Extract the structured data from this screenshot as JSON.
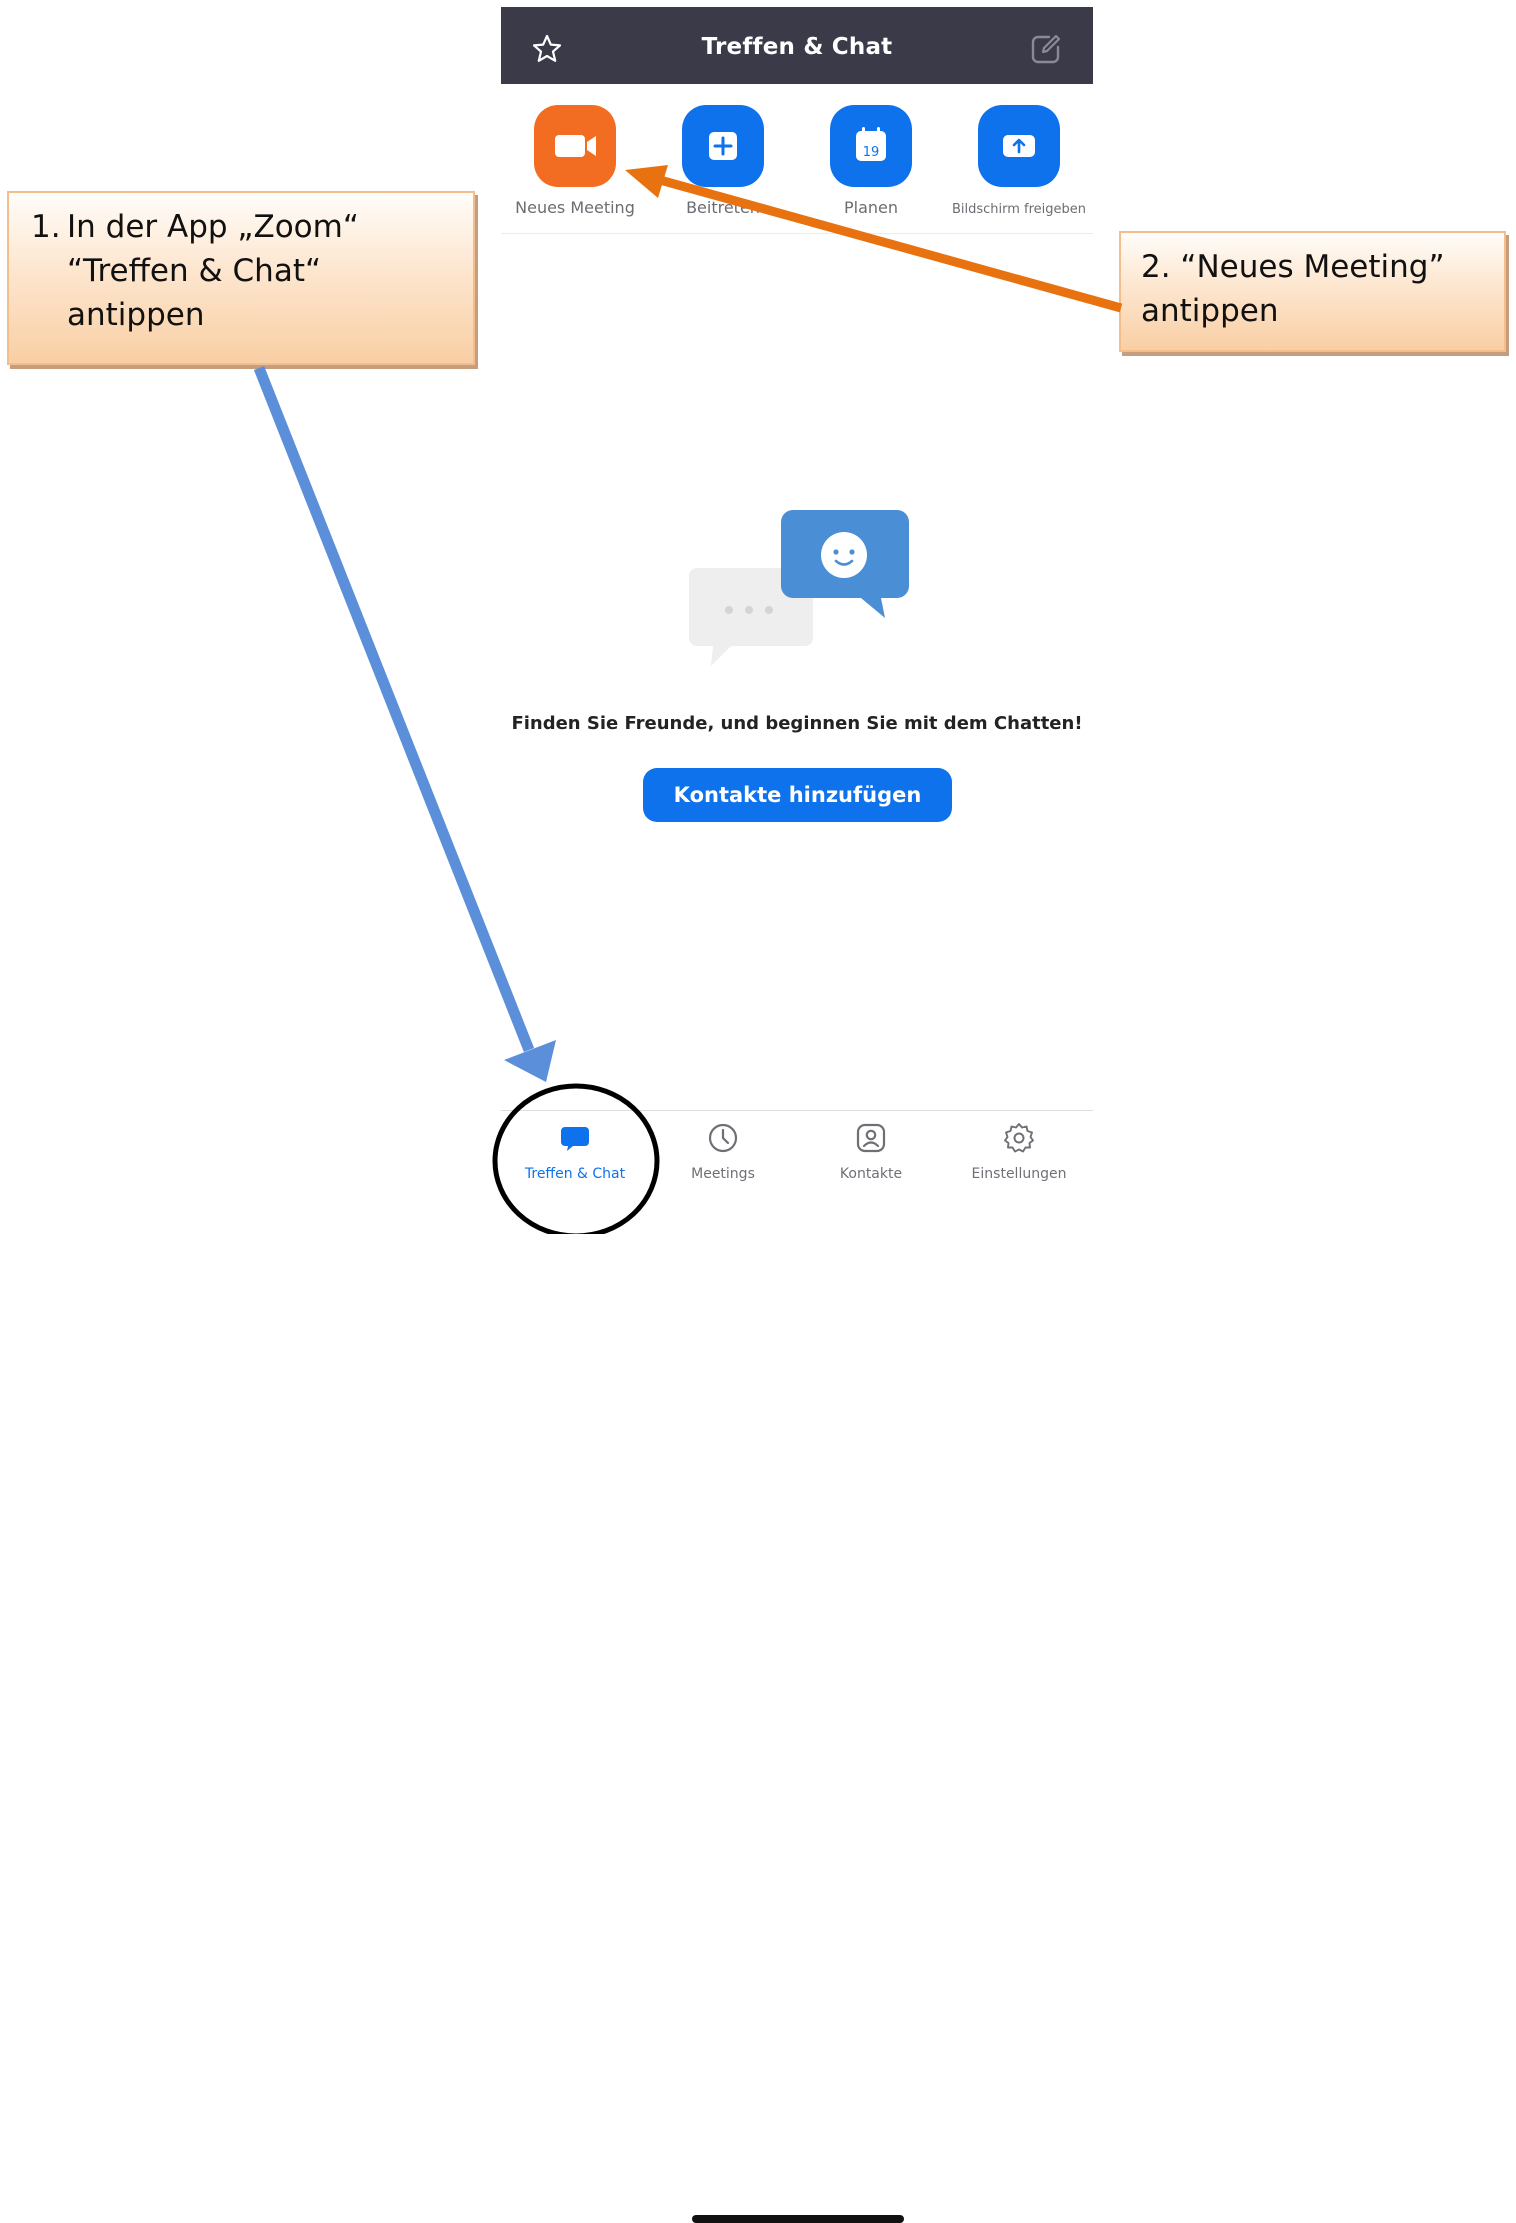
{
  "app": {
    "title": "Treffen & Chat"
  },
  "actions": [
    {
      "label": "Neues Meeting",
      "icon": "video-camera-icon",
      "color": "#f26d21"
    },
    {
      "label": "Beitreten",
      "icon": "plus-icon",
      "color": "#0e72ed"
    },
    {
      "label": "Planen",
      "icon": "calendar-icon",
      "color": "#0e72ed",
      "calendar_day": "19"
    },
    {
      "label": "Bildschirm freigeben",
      "icon": "share-screen-icon",
      "color": "#0e72ed"
    }
  ],
  "empty_state": {
    "message": "Finden Sie Freunde, und beginnen Sie mit dem Chatten!",
    "button_label": "Kontakte hinzufügen"
  },
  "tabs": [
    {
      "label": "Treffen & Chat",
      "icon": "chat-bubble-icon",
      "active": true
    },
    {
      "label": "Meetings",
      "icon": "clock-icon",
      "active": false
    },
    {
      "label": "Kontakte",
      "icon": "contact-icon",
      "active": false
    },
    {
      "label": "Einstellungen",
      "icon": "gear-icon",
      "active": false
    }
  ],
  "annotations": {
    "step1": {
      "number": "1.",
      "lines": [
        "In der App „Zoom“",
        "“Treffen & Chat“",
        "antippen"
      ]
    },
    "step2": {
      "lines": [
        "2. “Neues Meeting”",
        "antippen"
      ]
    }
  },
  "colors": {
    "topbar": "#3b3a49",
    "brand_blue": "#0e72ed",
    "orange": "#f26d21",
    "arrow_orange": "#e8720f",
    "arrow_blue": "#5b8fd9"
  }
}
